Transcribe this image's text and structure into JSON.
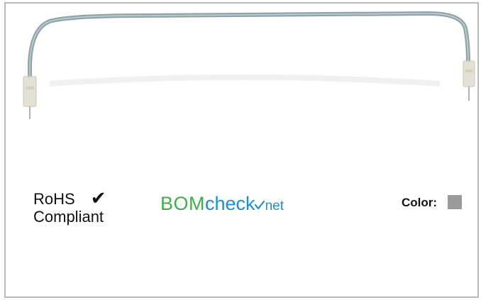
{
  "rohs": {
    "line1": "RoHS",
    "line2": "Compliant",
    "check_icon": "checkmark-icon"
  },
  "logo": {
    "part1": "BOM",
    "part2": "check",
    "part3": "net",
    "colors": {
      "bom": "#3fae49",
      "check": "#1d8fd0"
    }
  },
  "color": {
    "label": "Color:",
    "swatch": "#9a9a9a"
  },
  "product": {
    "icon": "jumper-wire-cable-image"
  }
}
